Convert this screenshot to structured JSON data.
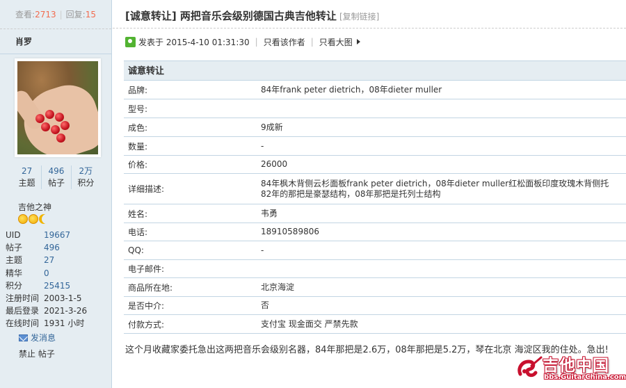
{
  "sidebar": {
    "stats": {
      "views_label": "查看:",
      "views": "2713",
      "replies_label": "回复:",
      "replies": "15"
    },
    "username": "肖罗",
    "counts": [
      {
        "value": "27",
        "label": "主题"
      },
      {
        "value": "496",
        "label": "帖子"
      },
      {
        "value": "2万",
        "label": "积分"
      }
    ],
    "group": "吉他之神",
    "info": [
      {
        "key": "UID",
        "value": "19667",
        "link": true
      },
      {
        "key": "帖子",
        "value": "496",
        "link": true
      },
      {
        "key": "主题",
        "value": "27",
        "link": true
      },
      {
        "key": "精华",
        "value": "0",
        "link": true
      },
      {
        "key": "积分",
        "value": "25415",
        "link": true
      },
      {
        "key": "注册时间",
        "value": "2003-1-5",
        "link": false
      },
      {
        "key": "最后登录",
        "value": "2021-3-26",
        "link": false
      },
      {
        "key": "在线时间",
        "value": "1931 小时",
        "link": false
      }
    ],
    "send_message": "发消息",
    "ban": "禁止 帖子"
  },
  "post": {
    "title": "[诚意转让] 两把音乐会级别德国古典吉他转让",
    "copy_link": "[复制链接]",
    "posted_at": "发表于 2015-4-10 01:31:30",
    "only_author": "只看该作者",
    "big_image": "只看大图",
    "form_title": "诚意转让",
    "fields": [
      {
        "key": "品牌:",
        "value": "84年frank peter dietrich，08年dieter muller"
      },
      {
        "key": "型号:",
        "value": ""
      },
      {
        "key": "成色:",
        "value": "9成新"
      },
      {
        "key": "数量:",
        "value": "-"
      },
      {
        "key": "价格:",
        "value": "26000"
      },
      {
        "key": "详细描述:",
        "value": "84年枫木背侧云杉面板frank peter dietrich，08年dieter muller红松面板印度玫瑰木背侧托",
        "value2": "82年的那把是豪瑟结构，08年那把是托列士结构"
      },
      {
        "key": "姓名:",
        "value": "韦勇"
      },
      {
        "key": "电话:",
        "value": "18910589806"
      },
      {
        "key": "QQ:",
        "value": "-"
      },
      {
        "key": "电子邮件:",
        "value": ""
      },
      {
        "key": "商品所在地:",
        "value": "北京海淀"
      },
      {
        "key": "是否中介:",
        "value": "否"
      },
      {
        "key": "付款方式:",
        "value": "支付宝 现金面交 严禁先款"
      }
    ],
    "body": "这个月收藏家委托急出这两把音乐会级别名器，84年那把是2.6万，08年那把是5.2万，琴在北京 海淀区我的住处。急出!"
  },
  "watermark": {
    "name": "吉他中国",
    "url": "bbs.GuitarChina.com"
  },
  "colors": {
    "link": "#336699",
    "highlight": "#F26C4F",
    "sidebar_bg": "#E5EDF2",
    "border": "#C2D5E3"
  }
}
